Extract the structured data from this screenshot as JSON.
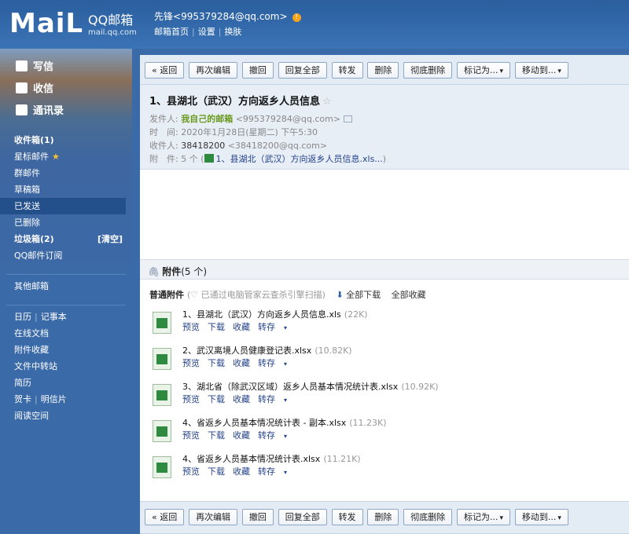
{
  "brand": {
    "word": "MaiL",
    "product": "QQ邮箱",
    "url": "mail.qq.com"
  },
  "user": {
    "name": "先锋",
    "email": "<995379284@qq.com>",
    "alert": "!"
  },
  "topnav": [
    "邮箱首页",
    "设置",
    "换肤"
  ],
  "sidebar": {
    "main": [
      {
        "label": "写信",
        "icon": "compose-icon"
      },
      {
        "label": "收信",
        "icon": "inbox-icon"
      },
      {
        "label": "通讯录",
        "icon": "contacts-icon"
      }
    ],
    "folders": [
      {
        "label": "收件箱(1)"
      },
      {
        "label": "星标邮件"
      },
      {
        "label": "群邮件"
      },
      {
        "label": "草稿箱"
      },
      {
        "label": "已发送"
      },
      {
        "label": "已删除"
      },
      {
        "label": "垃圾箱(2)",
        "action": "[清空]"
      },
      {
        "label": "QQ邮件订阅"
      }
    ],
    "other": "其他邮箱",
    "tools": {
      "calendar": "日历",
      "notes": "记事本",
      "docs": "在线文档",
      "fav": "附件收藏",
      "transfer": "文件中转站",
      "resume": "简历",
      "card": "贺卡",
      "postcard": "明信片",
      "reading": "阅读空间"
    }
  },
  "toolbar": {
    "back": "« 返回",
    "reedit": "再次编辑",
    "recall": "撤回",
    "replyall": "回复全部",
    "forward": "转发",
    "delete": "删除",
    "purge": "彻底删除",
    "markas": "标记为...",
    "moveto": "移动到..."
  },
  "mail": {
    "subject": "1、县湖北（武汉）方向返乡人员信息",
    "from_label": "发件人:",
    "from_name": "我自己的邮箱",
    "from_addr": "<995379284@qq.com>",
    "time_label": "时　间:",
    "time": "2020年1月28日(星期二) 下午5:30",
    "to_label": "收件人:",
    "to_name": "38418200",
    "to_addr": "<38418200@qq.com>",
    "att_label": "附　件:",
    "att_summary_pre": "5 个 (",
    "att_summary_link": "1、县湖北（武汉）方向返乡人员信息.xls...",
    "att_summary_post": ")"
  },
  "attachments": {
    "title": "附件",
    "count": "(5 个)",
    "section": "普通附件",
    "scan": "(♡ 已通过电脑管家云查杀引擎扫描)",
    "download_all": "全部下载",
    "fav_all": "全部收藏",
    "actions": {
      "preview": "预览",
      "download": "下载",
      "fav": "收藏",
      "saveto": "转存"
    },
    "files": [
      {
        "name": "1、县湖北（武汉）方向返乡人员信息.xls",
        "size": "(22K)"
      },
      {
        "name": "2、武汉离境人员健康登记表.xlsx",
        "size": "(10.82K)"
      },
      {
        "name": "3、湖北省（除武汉区域）返乡人员基本情况统计表.xlsx",
        "size": "(10.92K)"
      },
      {
        "name": "4、省返乡人员基本情况统计表 - 副本.xlsx",
        "size": "(11.23K)"
      },
      {
        "name": "4、省返乡人员基本情况统计表.xlsx",
        "size": "(11.21K)"
      }
    ]
  },
  "colors": {
    "header": "#2b5f9e",
    "sidebar": "#3b6aa8",
    "active": "#234f8a",
    "link": "#24428a",
    "sender": "#6a9a1f"
  }
}
